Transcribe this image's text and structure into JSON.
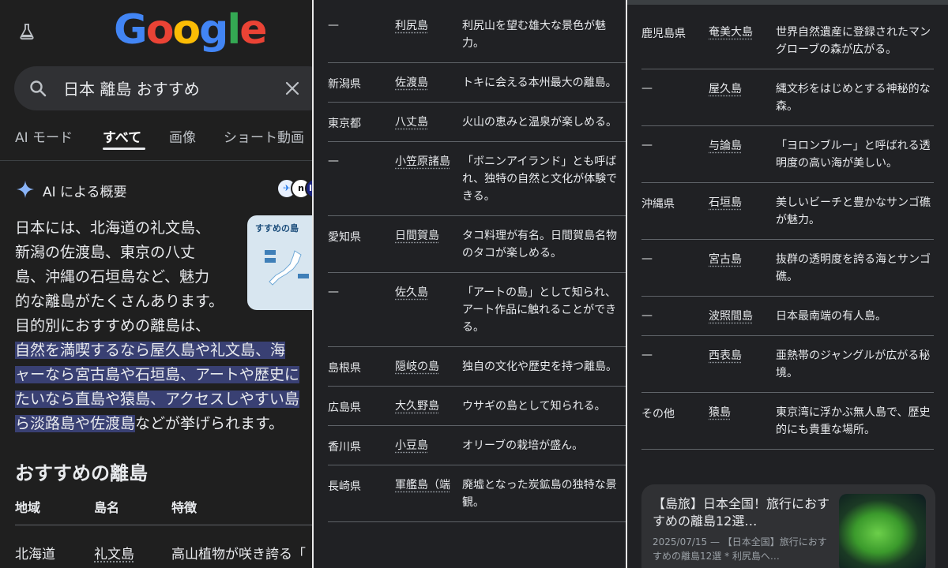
{
  "panel1": {
    "logo_letters": [
      {
        "ch": "G",
        "color": "#4285f4"
      },
      {
        "ch": "o",
        "color": "#ea4335"
      },
      {
        "ch": "o",
        "color": "#fbbc05"
      },
      {
        "ch": "g",
        "color": "#4285f4"
      },
      {
        "ch": "l",
        "color": "#34a853"
      },
      {
        "ch": "e",
        "color": "#ea4335"
      }
    ],
    "search_query": "日本 離島 おすすめ",
    "tabs": [
      "AI モード",
      "すべて",
      "画像",
      "ショート動画"
    ],
    "active_tab": "すべて",
    "ai_title": "AI による概要",
    "thumbnail_title": "すすめの島",
    "summary_lines": [
      {
        "text": "日本には、北海道の礼文島、",
        "hl": false
      },
      {
        "text": "新潟の佐渡島、東京の八丈",
        "hl": false
      },
      {
        "text": "島、沖縄の石垣島など、魅力",
        "hl": false
      },
      {
        "text": "的な離島がたくさんあります。",
        "hl": false
      },
      {
        "text": "目的別におすすめの離島は、",
        "hl": false
      },
      {
        "text": "自然を満喫するなら屋久島や礼文島、海",
        "hl": true
      },
      {
        "text": "ャーなら宮古島や石垣島、アートや歴史に",
        "hl": true
      },
      {
        "text": "たいなら直島や猿島、アクセスしやすい島",
        "hl": true
      }
    ],
    "summary_last_hl": "ら淡路島や佐渡島",
    "summary_last_rest": "などが挙げられます。",
    "section_title": "おすすめの離島",
    "table_headers": [
      "地域",
      "島名",
      "特徴"
    ],
    "first_row": {
      "region": "北海道",
      "island": "礼文島",
      "feature": "高山植物が咲き誇る「"
    }
  },
  "panel2": {
    "rows": [
      {
        "region": "—",
        "island": "利尻島",
        "feature": "利尻山を望む雄大な景色が魅力。"
      },
      {
        "region": "新潟県",
        "island": "佐渡島",
        "feature": "トキに会える本州最大の離島。"
      },
      {
        "region": "東京都",
        "island": "八丈島",
        "feature": "火山の恵みと温泉が楽しめる。"
      },
      {
        "region": "—",
        "island": "小笠原諸島",
        "feature": "「ボニンアイランド」とも呼ばれ、独特の自然と文化が体験できる。"
      },
      {
        "region": "愛知県",
        "island": "日間賀島",
        "feature": "タコ料理が有名。日間賀島名物のタコが楽しめる。"
      },
      {
        "region": "—",
        "island": "佐久島",
        "feature": "「アートの島」として知られ、アート作品に触れることができる。"
      },
      {
        "region": "島根県",
        "island": "隠岐の島",
        "feature": "独自の文化や歴史を持つ離島。"
      },
      {
        "region": "広島県",
        "island": "大久野島",
        "feature": "ウサギの島として知られる。"
      },
      {
        "region": "香川県",
        "island": "小豆島",
        "feature": "オリーブの栽培が盛ん。"
      },
      {
        "region": "長崎県",
        "island": "軍艦島（端",
        "feature": "廃墟となった炭鉱島の独特な景観。"
      }
    ]
  },
  "panel3": {
    "rows": [
      {
        "region": "鹿児島県",
        "island": "奄美大島",
        "feature": "世界自然遺産に登録されたマングローブの森が広がる。"
      },
      {
        "region": "—",
        "island": "屋久島",
        "feature": "縄文杉をはじめとする神秘的な森。"
      },
      {
        "region": "—",
        "island": "与論島",
        "feature": "「ヨロンブルー」と呼ばれる透明度の高い海が美しい。"
      },
      {
        "region": "沖縄県",
        "island": "石垣島",
        "feature": "美しいビーチと豊かなサンゴ礁が魅力。"
      },
      {
        "region": "—",
        "island": "宮古島",
        "feature": "抜群の透明度を誇る海とサンゴ礁。"
      },
      {
        "region": "—",
        "island": "波照間島",
        "feature": "日本最南端の有人島。"
      },
      {
        "region": "—",
        "island": "西表島",
        "feature": "亜熱帯のジャングルが広がる秘境。"
      },
      {
        "region": "その他",
        "island": "猿島",
        "feature": "東京湾に浮かぶ無人島で、歴史的にも貴重な場所。"
      }
    ],
    "news_title": "【島旅】日本全国！旅行におすすめの離島12選…",
    "news_meta": "2025/07/15 — 【日本全国】旅行におすすめの離島12選 * 利尻島へ…"
  }
}
